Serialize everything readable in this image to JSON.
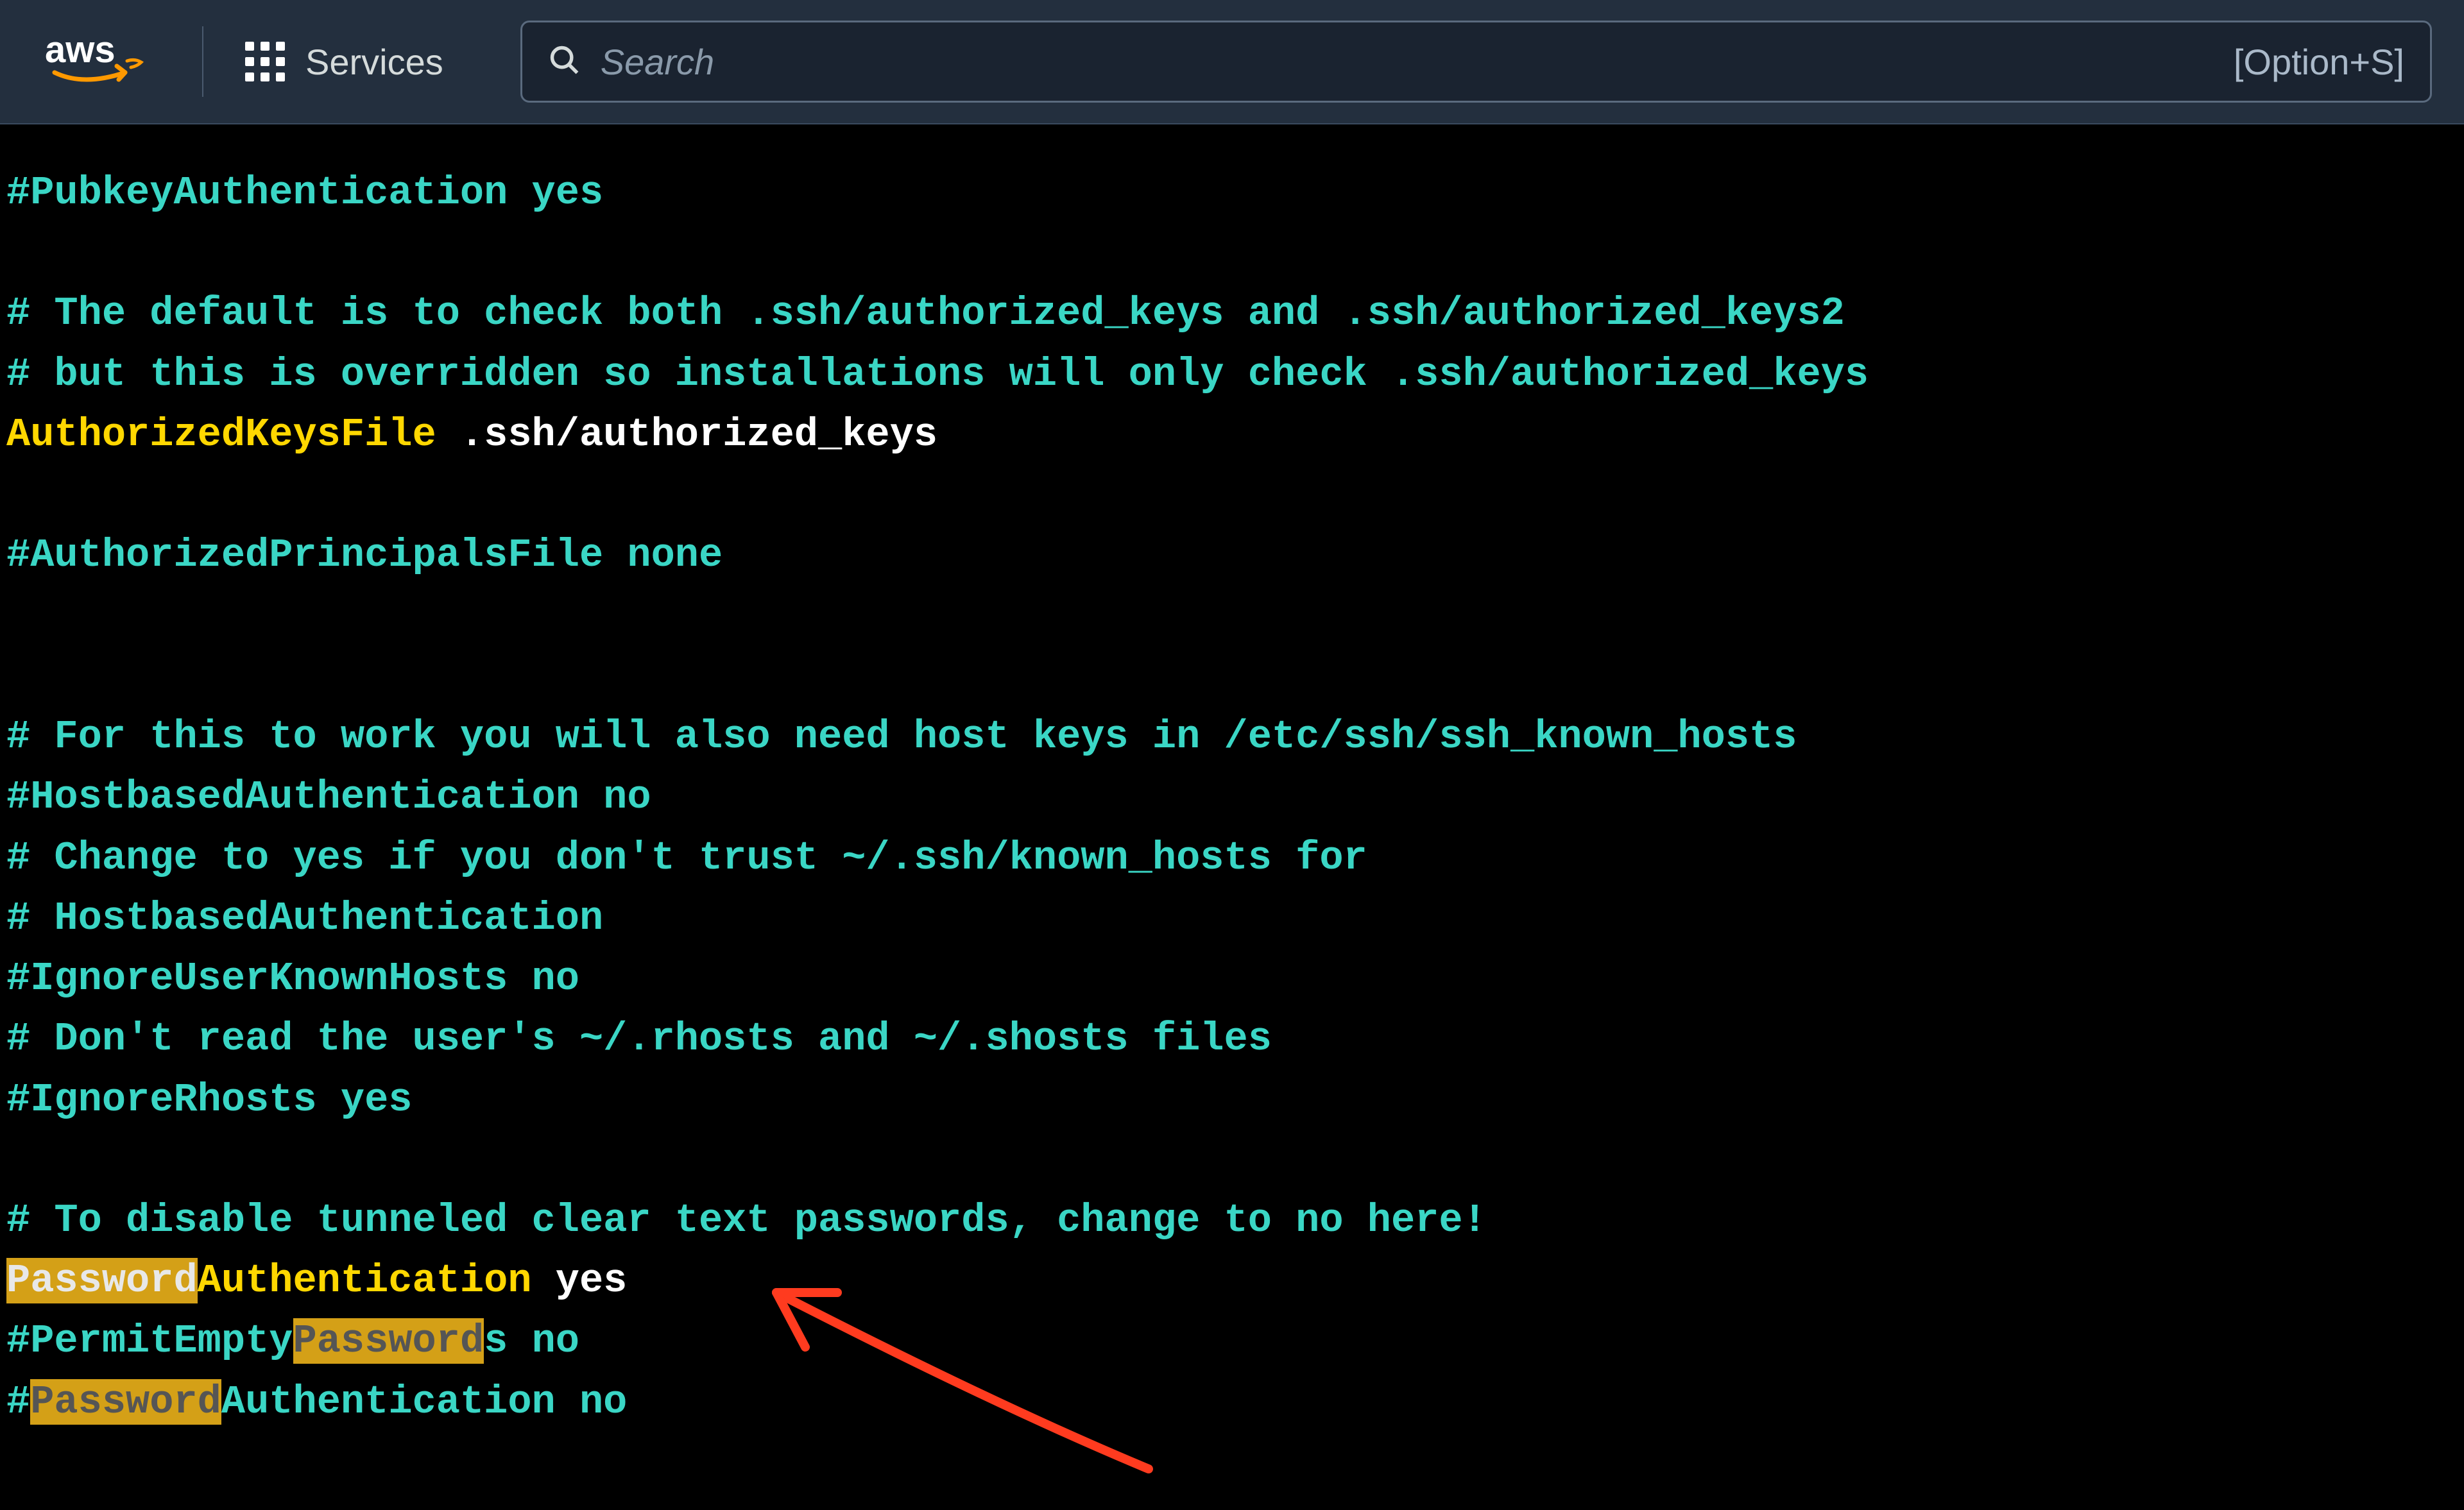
{
  "header": {
    "logo_text": "aws",
    "services_label": "Services",
    "search": {
      "placeholder": "Search",
      "shortcut": "[Option+S]"
    }
  },
  "terminal": {
    "line01": "#PubkeyAuthentication yes",
    "line02": "# The default is to check both .ssh/authorized_keys and .ssh/authorized_keys2",
    "line03": "# but this is overridden so installations will only check .ssh/authorized_keys",
    "line04_key": "AuthorizedKeysFile",
    "line04_val": " .ssh/authorized_keys",
    "line05": "#AuthorizedPrincipalsFile none",
    "line06": "# For this to work you will also need host keys in /etc/ssh/ssh_known_hosts",
    "line07": "#HostbasedAuthentication no",
    "line08": "# Change to yes if you don't trust ~/.ssh/known_hosts for",
    "line09": "# HostbasedAuthentication",
    "line10": "#IgnoreUserKnownHosts no",
    "line11": "# Don't read the user's ~/.rhosts and ~/.shosts files",
    "line12": "#IgnoreRhosts yes",
    "line13": "# To disable tunneled clear text passwords, change to no here!",
    "line14_hl": "Password",
    "line14_rest": "Authentication",
    "line14_val": " yes",
    "line15_pre": "#",
    "line15_a": "PermitEmpty",
    "line15_hl": "Password",
    "line15_b": "s",
    "line15_val": " no",
    "line16_pre": "#",
    "line16_hl": "Password",
    "line16_rest": "Authentication no"
  },
  "colors": {
    "header_bg": "#232f3e",
    "terminal_bg": "#000000",
    "cyan": "#3ad6c5",
    "yellow": "#ffd700",
    "highlight_bg": "#d4a017",
    "arrow": "#ff3b1f"
  }
}
